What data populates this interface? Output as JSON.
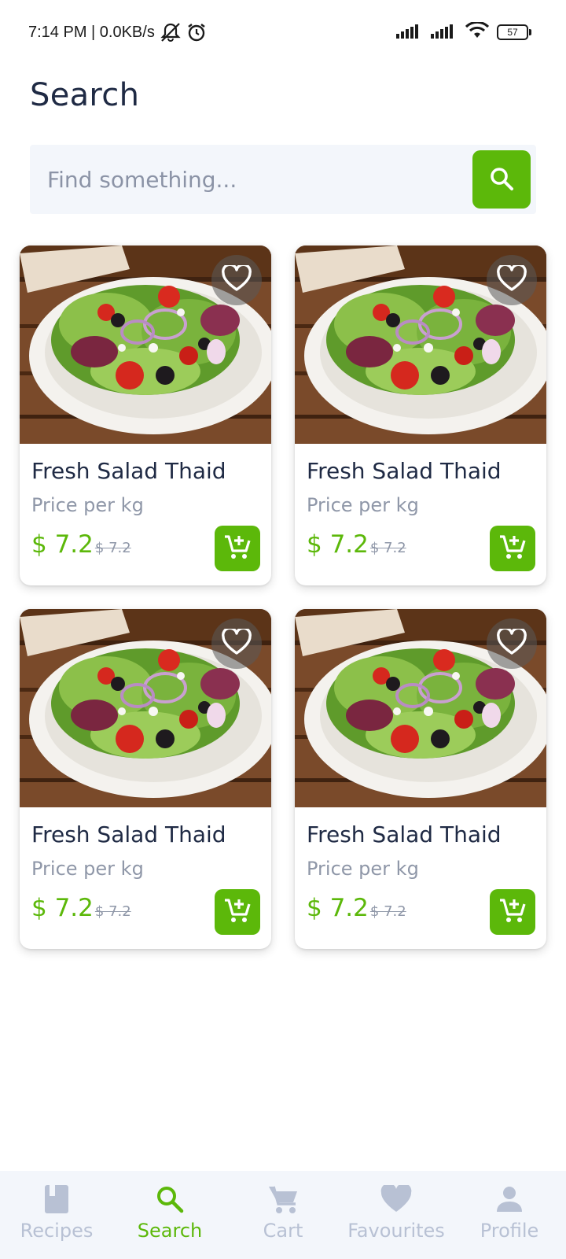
{
  "status_bar": {
    "time_speed": "7:14 PM | 0.0KB/s",
    "battery": "57"
  },
  "page": {
    "title": "Search"
  },
  "search": {
    "placeholder": "Find something..."
  },
  "colors": {
    "accent": "#5cb80a",
    "text": "#1f2a44",
    "muted": "#8f97a8",
    "nav_inactive": "#b8c1d4",
    "search_bg": "#f3f6fb"
  },
  "products": [
    {
      "name": "Fresh Salad Thaid",
      "subtitle": "Price per kg",
      "price": "$ 7.2",
      "old_price": "$ 7.2"
    },
    {
      "name": "Fresh Salad Thaid",
      "subtitle": "Price per kg",
      "price": "$ 7.2",
      "old_price": "$ 7.2"
    },
    {
      "name": "Fresh Salad Thaid",
      "subtitle": "Price per kg",
      "price": "$ 7.2",
      "old_price": "$ 7.2"
    },
    {
      "name": "Fresh Salad Thaid",
      "subtitle": "Price per kg",
      "price": "$ 7.2",
      "old_price": "$ 7.2"
    }
  ],
  "nav": {
    "items": [
      {
        "label": "Recipes",
        "icon": "book-icon",
        "active": false
      },
      {
        "label": "Search",
        "icon": "search-icon",
        "active": true
      },
      {
        "label": "Cart",
        "icon": "cart-icon",
        "active": false
      },
      {
        "label": "Favourites",
        "icon": "heart-icon",
        "active": false
      },
      {
        "label": "Profile",
        "icon": "person-icon",
        "active": false
      }
    ]
  }
}
